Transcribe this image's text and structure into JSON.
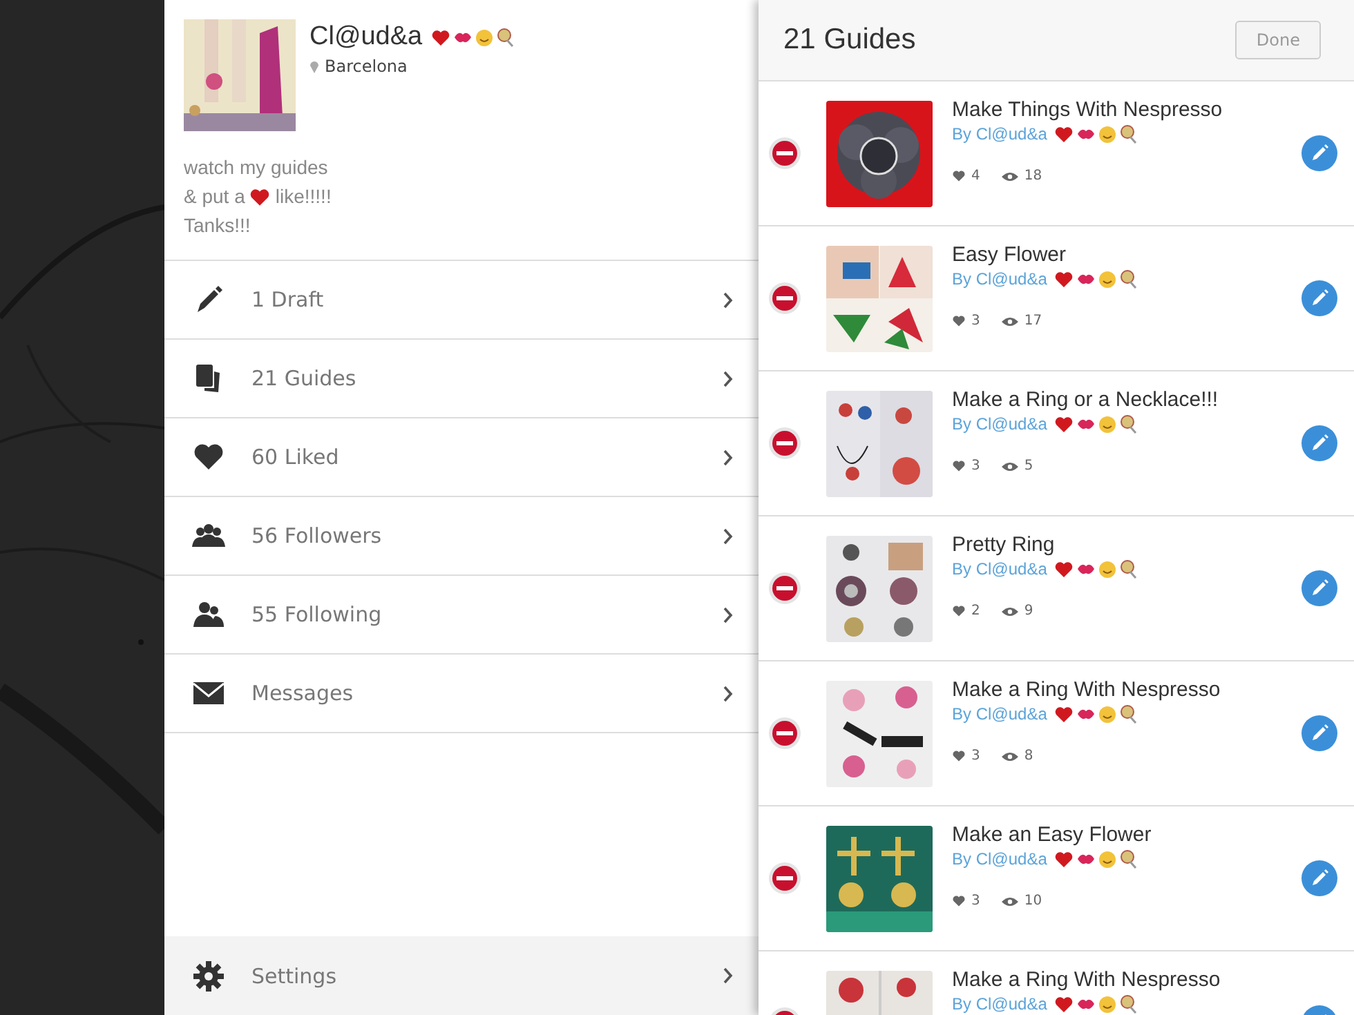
{
  "profile": {
    "name": "Cl@ud&a",
    "location": "Barcelona",
    "bio": [
      "watch my guides",
      "& put a",
      "like!!!!!",
      "Tanks!!!"
    ]
  },
  "menu": [
    {
      "kind": "draft",
      "label": "1 Draft"
    },
    {
      "kind": "guides",
      "label": "21 Guides"
    },
    {
      "kind": "liked",
      "label": "60 Liked"
    },
    {
      "kind": "followers",
      "label": "56 Followers"
    },
    {
      "kind": "following",
      "label": "55 Following"
    },
    {
      "kind": "messages",
      "label": "Messages"
    }
  ],
  "settings": {
    "label": "Settings"
  },
  "guides_panel": {
    "title": "21 Guides",
    "done_button": "Done",
    "guides": [
      {
        "title": "Make Things With Nespresso",
        "author": "By Cl@ud&a",
        "likes": "4",
        "views": "18"
      },
      {
        "title": "Easy Flower",
        "author": "By Cl@ud&a",
        "likes": "3",
        "views": "17"
      },
      {
        "title": "Make a Ring or a Necklace!!!",
        "author": "By Cl@ud&a",
        "likes": "3",
        "views": "5"
      },
      {
        "title": "Pretty Ring",
        "author": "By Cl@ud&a",
        "likes": "2",
        "views": "9"
      },
      {
        "title": "Make a Ring With Nespresso",
        "author": "By Cl@ud&a",
        "likes": "3",
        "views": "8"
      },
      {
        "title": "Make an Easy Flower",
        "author": "By Cl@ud&a",
        "likes": "3",
        "views": "10"
      },
      {
        "title": "Make a Ring With Nespresso",
        "author": "By Cl@ud&a"
      }
    ]
  }
}
